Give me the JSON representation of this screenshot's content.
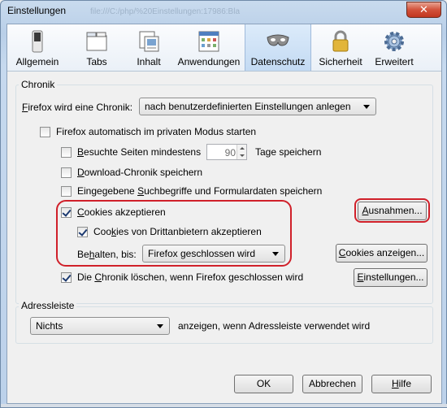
{
  "window": {
    "title": "Einstellungen",
    "ghost_url": "file:///C:/php/%20Einstellungen:17986:Bla",
    "close_glyph": "✕"
  },
  "tabs": [
    {
      "label": "Allgemein",
      "icon": "switch-icon"
    },
    {
      "label": "Tabs",
      "icon": "tabs-icon"
    },
    {
      "label": "Inhalt",
      "icon": "content-icon"
    },
    {
      "label": "Anwendungen",
      "icon": "applications-icon"
    },
    {
      "label": "Datenschutz",
      "icon": "privacy-mask-icon",
      "selected": true
    },
    {
      "label": "Sicherheit",
      "icon": "padlock-icon"
    },
    {
      "label": "Erweitert",
      "icon": "gear-icon"
    }
  ],
  "chronik": {
    "group_label": "Chronik",
    "firefox_label_pre": "F",
    "firefox_label_rest": "irefox wird eine Chronik:",
    "history_mode": "nach benutzerdefinierten Einstellungen anlegen",
    "private_mode": {
      "label": "Firefox automatisch im privaten Modus starten",
      "checked": false
    },
    "visited": {
      "label_u": "B",
      "label_rest": "esuchte Seiten mindestens",
      "days": "90",
      "suffix": "Tage speichern",
      "checked": false
    },
    "download": {
      "label_u": "D",
      "label_rest": "ownload-Chronik speichern",
      "checked": false
    },
    "search": {
      "label_pre": "Eingegebene ",
      "label_u": "S",
      "label_rest": "uchbegriffe und Formulardaten speichern",
      "checked": false
    },
    "cookies": {
      "label_u": "C",
      "label_rest": "ookies akzeptieren",
      "checked": true
    },
    "exceptions_button": {
      "label_u": "A",
      "label_rest": "usnahmen..."
    },
    "third_party": {
      "label_pre": "Coo",
      "label_u": "k",
      "label_rest": "ies von Drittanbietern akzeptieren",
      "checked": true
    },
    "keep": {
      "label_pre": "Be",
      "label_u": "h",
      "label_rest": "alten, bis:",
      "value": "Firefox geschlossen wird"
    },
    "show_cookies_button": {
      "label_u": "C",
      "label_rest": "ookies anzeigen..."
    },
    "clear_on_close": {
      "label_pre": "Die ",
      "label_u": "C",
      "label_rest": "hronik löschen, wenn Firefox geschlossen wird",
      "checked": true
    },
    "settings_button": {
      "label_u": "E",
      "label_rest": "instellungen..."
    }
  },
  "adressleiste": {
    "group_label": "Adressleiste",
    "value": "Nichts",
    "suffix": "anzeigen, wenn Adressleiste verwendet wird"
  },
  "footer": {
    "ok": "OK",
    "cancel": "Abbrechen",
    "help_u": "H",
    "help_rest": "ilfe"
  },
  "colors": {
    "highlight_ring": "#d0202a",
    "selected_tab": "#c3daf3"
  }
}
